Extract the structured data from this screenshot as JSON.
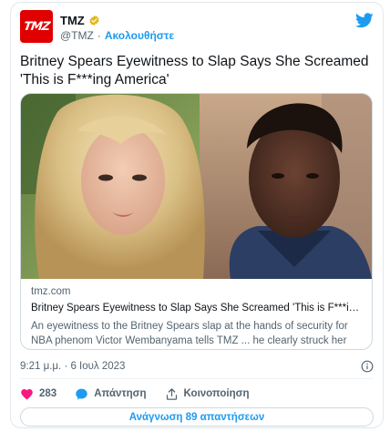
{
  "tweet": {
    "author": {
      "avatar_text": "TMZ",
      "name": "TMZ",
      "handle": "@TMZ",
      "separator": "·",
      "follow_label": "Ακολουθήστε"
    },
    "text": "Britney Spears Eyewitness to Slap Says She Screamed 'This is F***ing America'",
    "link_card": {
      "domain": "tmz.com",
      "title": "Britney Spears Eyewitness to Slap Says She Screamed 'This is F***ing America'",
      "description": "An eyewitness to the Britney Spears slap at the hands of security for NBA phenom Victor Wembanyama tells TMZ ... he clearly struck her and she ..."
    },
    "timestamp": "9:21 μ.μ. · 6 Ιουλ 2023",
    "actions": {
      "like_count": "283",
      "reply_label": "Απάντηση",
      "share_label": "Κοινοποίηση"
    },
    "read_replies_label": "Ανάγνωση 89 απαντήσεων"
  },
  "colors": {
    "accent": "#1d9bf0",
    "like": "#f91880",
    "brand_tmz": "#e00000",
    "verified": "#e2b719"
  },
  "icons": [
    "twitter-bird-icon",
    "verified-badge-icon",
    "info-icon",
    "heart-icon",
    "reply-bubble-icon",
    "share-icon"
  ]
}
